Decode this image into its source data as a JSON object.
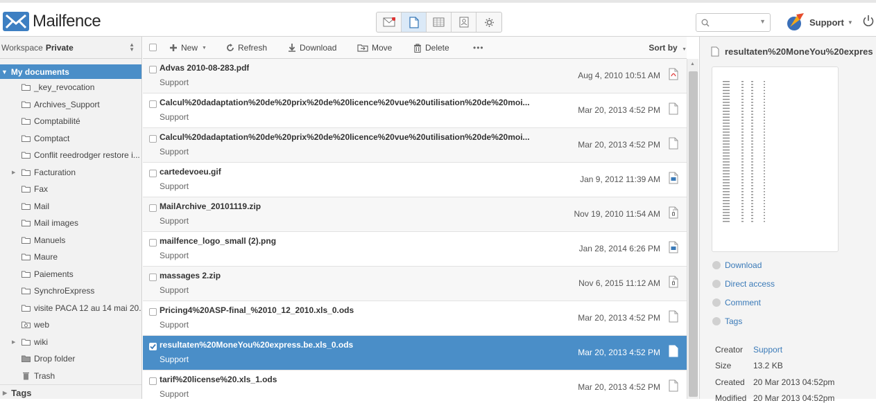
{
  "app": {
    "name": "Mailfence"
  },
  "header": {
    "apps": [
      "mail-icon",
      "documents-icon",
      "calendar-icon",
      "contacts-icon",
      "settings-icon"
    ],
    "search_placeholder": "",
    "user": "Support"
  },
  "sidebar": {
    "workspace_label": "Workspace",
    "workspace_value": "Private",
    "root": "My documents",
    "folders": [
      {
        "label": "_key_revocation",
        "expandable": false
      },
      {
        "label": "Archives_Support",
        "expandable": false
      },
      {
        "label": "Comptabilité",
        "expandable": false
      },
      {
        "label": "Comptact",
        "expandable": false
      },
      {
        "label": "Conflit reedrodger restore i...",
        "expandable": false
      },
      {
        "label": "Facturation",
        "expandable": true
      },
      {
        "label": "Fax",
        "expandable": false
      },
      {
        "label": "Mail",
        "expandable": false
      },
      {
        "label": "Mail images",
        "expandable": false
      },
      {
        "label": "Manuels",
        "expandable": false
      },
      {
        "label": "Maure",
        "expandable": false
      },
      {
        "label": "Paiements",
        "expandable": false
      },
      {
        "label": "SynchroExpress",
        "expandable": false
      },
      {
        "label": "visite PACA 12 au 14 mai 20...",
        "expandable": false
      },
      {
        "label": "web",
        "expandable": false
      },
      {
        "label": "wiki",
        "expandable": true
      },
      {
        "label": "Drop folder",
        "expandable": false
      },
      {
        "label": "Trash",
        "expandable": false
      }
    ],
    "tags": "Tags"
  },
  "toolbar": {
    "new": "New",
    "refresh": "Refresh",
    "download": "Download",
    "move": "Move",
    "delete": "Delete",
    "more": "•••",
    "sort": "Sort by"
  },
  "files": [
    {
      "name": "Advas 2010-08-283.pdf",
      "owner": "Support",
      "date": "Aug 4, 2010 10:51 AM",
      "type": "pdf",
      "selected": false
    },
    {
      "name": "Calcul%20dadaptation%20de%20prix%20de%20licence%20vue%20utilisation%20de%20moi...",
      "owner": "Support",
      "date": "Mar 20, 2013 4:52 PM",
      "type": "doc",
      "selected": false
    },
    {
      "name": "Calcul%20dadaptation%20de%20prix%20de%20licence%20vue%20utilisation%20de%20moi...",
      "owner": "Support",
      "date": "Mar 20, 2013 4:52 PM",
      "type": "doc",
      "selected": false
    },
    {
      "name": "cartedevoeu.gif",
      "owner": "Support",
      "date": "Jan 9, 2012 11:39 AM",
      "type": "image",
      "selected": false
    },
    {
      "name": "MailArchive_20101119.zip",
      "owner": "Support",
      "date": "Nov 19, 2010 11:54 AM",
      "type": "zip",
      "selected": false
    },
    {
      "name": "mailfence_logo_small (2).png",
      "owner": "Support",
      "date": "Jan 28, 2014 6:26 PM",
      "type": "image",
      "selected": false
    },
    {
      "name": "massages 2.zip",
      "owner": "Support",
      "date": "Nov 6, 2015 11:12 AM",
      "type": "zip",
      "selected": false
    },
    {
      "name": "Pricing4%20ASP-final_%2010_12_2010.xls_0.ods",
      "owner": "Support",
      "date": "Mar 20, 2013 4:52 PM",
      "type": "doc",
      "selected": false
    },
    {
      "name": "resultaten%20MoneYou%20express.be.xls_0.ods",
      "owner": "Support",
      "date": "Mar 20, 2013 4:52 PM",
      "type": "doc",
      "selected": true
    },
    {
      "name": "tarif%20license%20.xls_1.ods",
      "owner": "Support",
      "date": "Mar 20, 2013 4:52 PM",
      "type": "doc",
      "selected": false
    }
  ],
  "preview": {
    "title": "resultaten%20MoneYou%20expres",
    "actions": [
      "Download",
      "Direct access",
      "Comment",
      "Tags"
    ],
    "meta": [
      {
        "key": "Creator",
        "value": "Support",
        "link": true
      },
      {
        "key": "Size",
        "value": "13.2 KB",
        "link": false
      },
      {
        "key": "Created",
        "value": "20 Mar 2013 04:52pm",
        "link": false
      },
      {
        "key": "Modified",
        "value": "20 Mar 2013 04:52pm",
        "link": false
      }
    ]
  },
  "colors": {
    "accent": "#4a8ec8",
    "link": "#3a7ab8"
  }
}
